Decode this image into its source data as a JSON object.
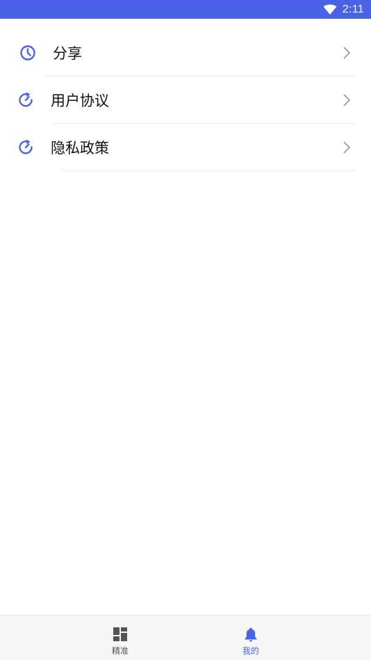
{
  "status_bar": {
    "time": "2:11",
    "background_color": "#4a63e6",
    "icons": [
      "wifi-icon"
    ]
  },
  "menu": {
    "accent_color": "#4a63e6",
    "items": [
      {
        "label": "分享",
        "icon": "clock-icon"
      },
      {
        "label": "用户协议",
        "icon": "refresh-icon"
      },
      {
        "label": "隐私政策",
        "icon": "refresh-icon"
      }
    ],
    "chevron_icon": "chevron-right-icon"
  },
  "bottom_nav": {
    "active_color": "#4a63e6",
    "inactive_color": "#555555",
    "tabs": [
      {
        "label": "精准",
        "icon": "dashboard-icon",
        "active": false
      },
      {
        "label": "我的",
        "icon": "bell-icon",
        "active": true
      }
    ]
  }
}
